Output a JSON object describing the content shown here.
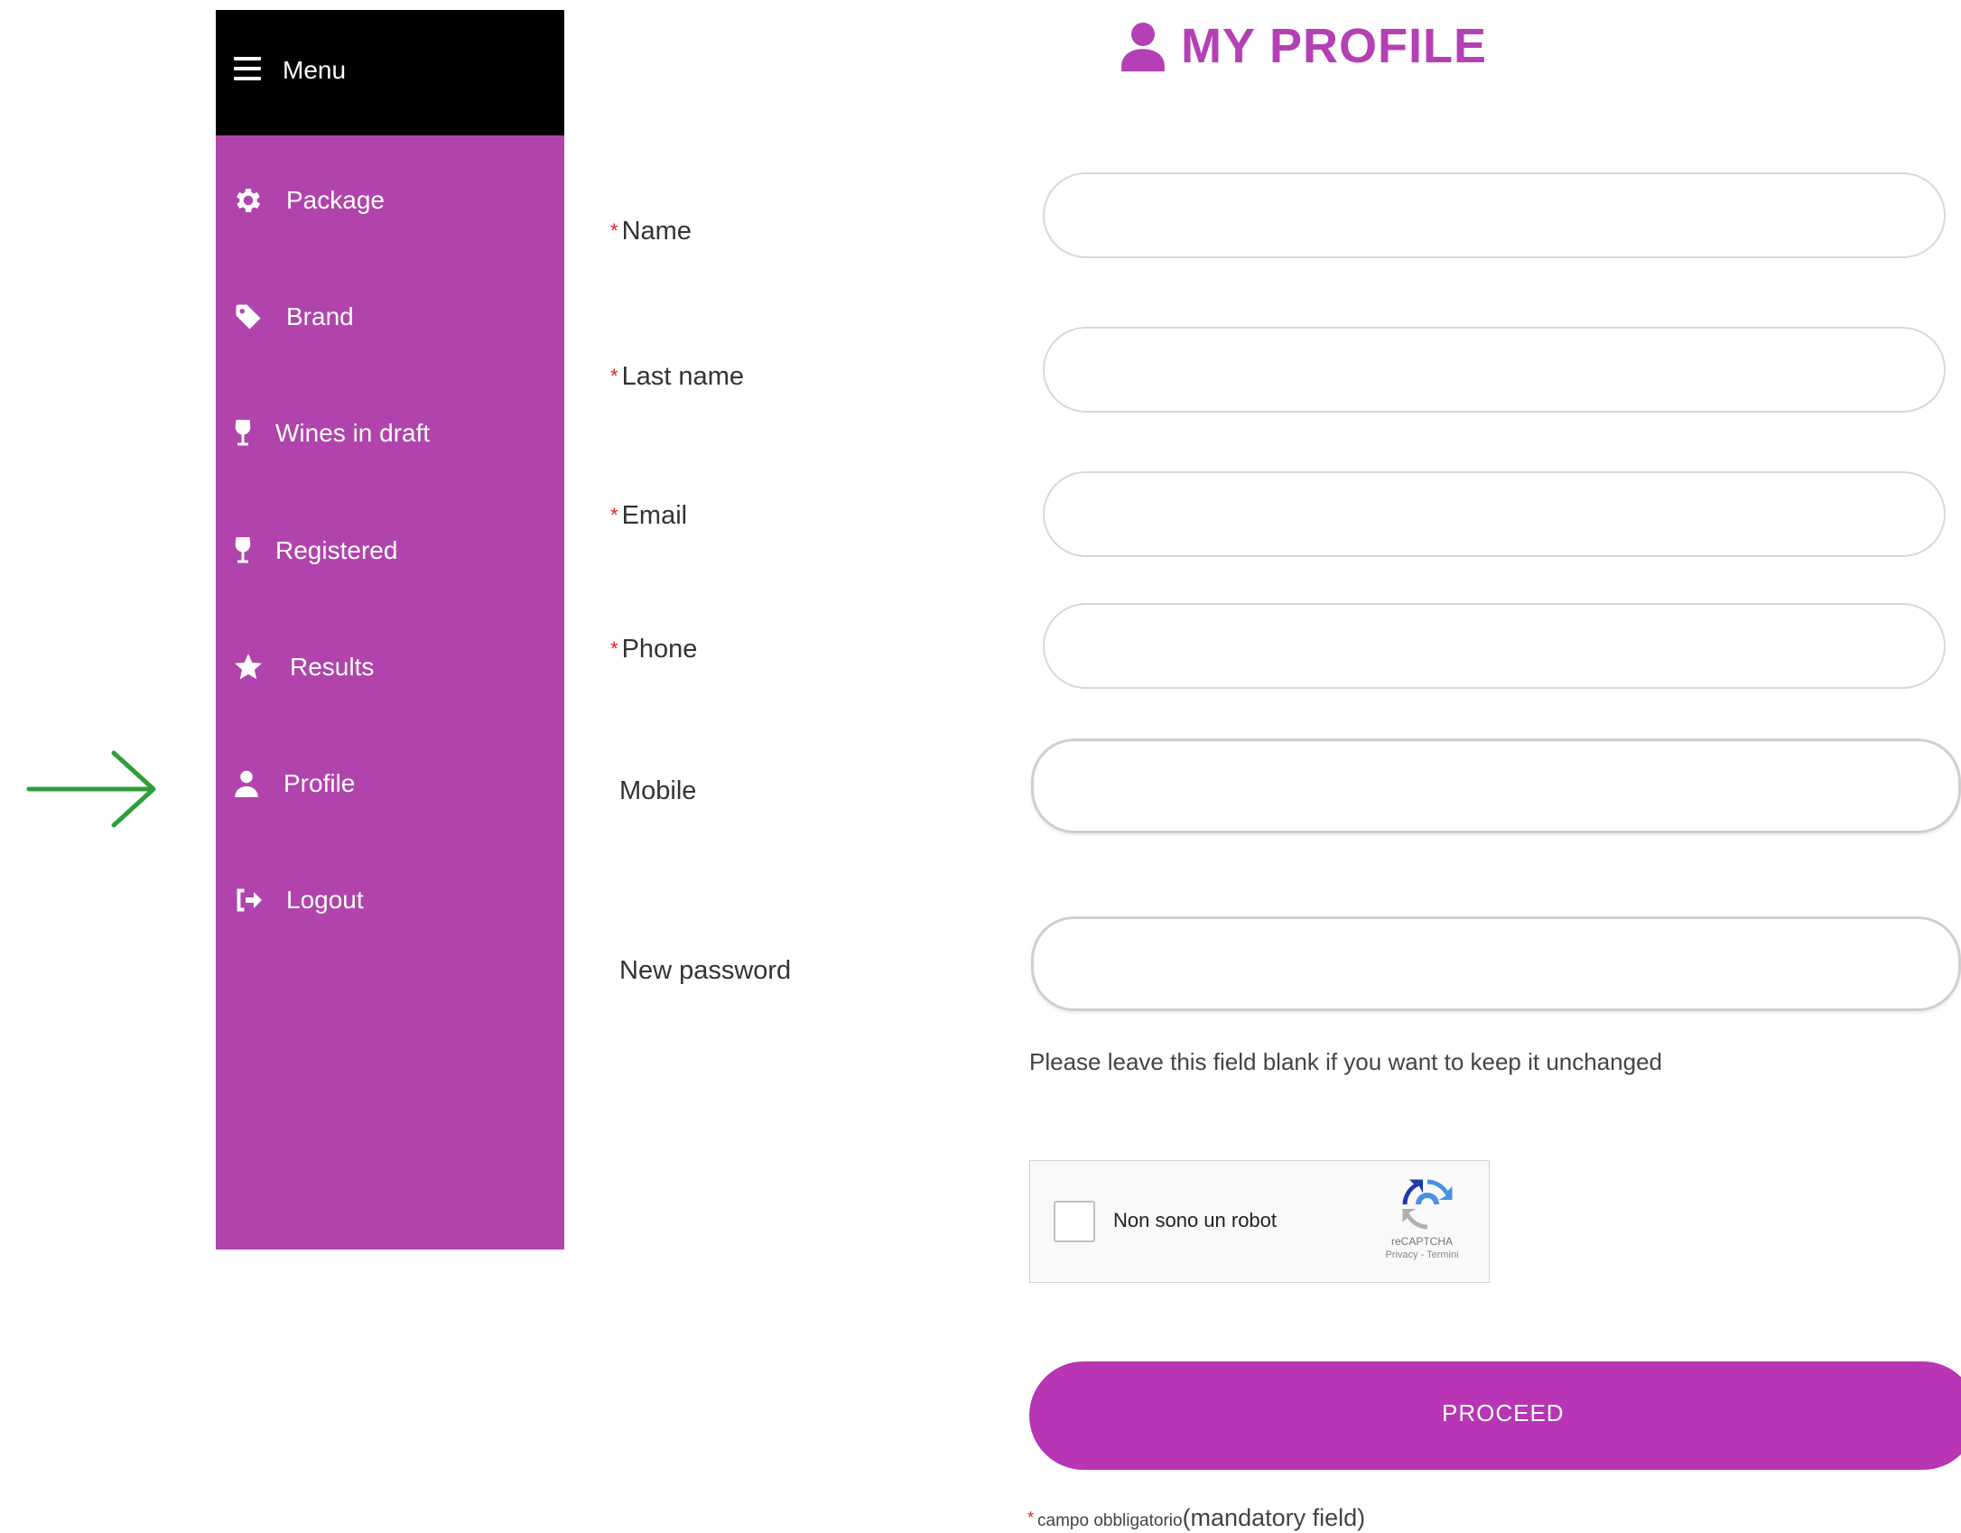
{
  "sidebar": {
    "menu_label": "Menu",
    "items": [
      {
        "label": "Package",
        "icon": "gear-icon"
      },
      {
        "label": "Brand",
        "icon": "tag-icon"
      },
      {
        "label": "Wines in draft",
        "icon": "wine-glass-icon"
      },
      {
        "label": "Registered",
        "icon": "wine-glass-icon"
      },
      {
        "label": "Results",
        "icon": "star-icon"
      },
      {
        "label": "Profile",
        "icon": "user-icon"
      },
      {
        "label": "Logout",
        "icon": "logout-icon"
      }
    ],
    "active_item": "Profile"
  },
  "header": {
    "title": "MY PROFILE",
    "icon": "user-icon"
  },
  "form": {
    "required_marker": "*",
    "fields": {
      "name": {
        "label": "Name",
        "value": ""
      },
      "last_name": {
        "label": "Last name",
        "value": ""
      },
      "email": {
        "label": "Email",
        "value": ""
      },
      "phone": {
        "label": "Phone",
        "value": ""
      },
      "mobile": {
        "label": "Mobile",
        "value": ""
      },
      "new_password": {
        "label": "New password",
        "value": ""
      }
    },
    "password_hint": "Please leave this field blank if you want to keep it unchanged",
    "captcha": {
      "label": "Non sono un robot",
      "brand": "reCAPTCHA",
      "terms": "Privacy - Termini"
    },
    "proceed_label": "PROCEED",
    "footnote": {
      "italian": "campo obbligatorio",
      "english": "(mandatory field)"
    }
  },
  "colors": {
    "sidebar_bg": "#b044ac",
    "header_bg": "#000000",
    "accent": "#b835b5",
    "required": "#e02020",
    "arrow": "#2e9e3a"
  }
}
